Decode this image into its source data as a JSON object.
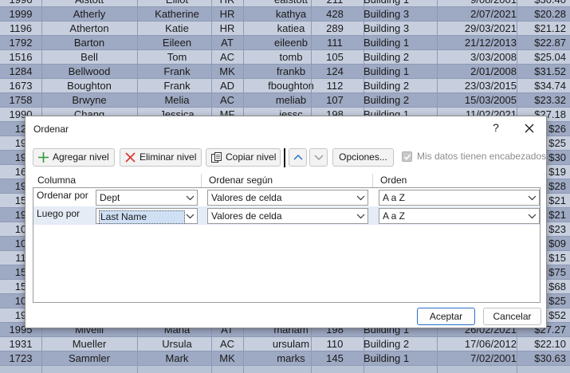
{
  "sheet": {
    "rows": [
      [
        "1996",
        "Alstott",
        "Elliot",
        "HR",
        "ealstott",
        "211",
        "Building 1",
        "9/08/2001",
        "$30.40"
      ],
      [
        "1999",
        "Atherly",
        "Katherine",
        "HR",
        "kathya",
        "428",
        "Building 3",
        "2/07/2021",
        "$20.28"
      ],
      [
        "1196",
        "Atherton",
        "Katie",
        "HR",
        "katiea",
        "289",
        "Building 3",
        "29/03/2021",
        "$21.12"
      ],
      [
        "1792",
        "Barton",
        "Eileen",
        "AT",
        "eileenb",
        "111",
        "Building 1",
        "21/12/2013",
        "$22.87"
      ],
      [
        "1516",
        "Bell",
        "Tom",
        "AC",
        "tomb",
        "105",
        "Building 2",
        "3/03/2008",
        "$25.04"
      ],
      [
        "1284",
        "Bellwood",
        "Frank",
        "MK",
        "frankb",
        "124",
        "Building 1",
        "2/01/2008",
        "$31.52"
      ],
      [
        "1673",
        "Boughton",
        "Frank",
        "AD",
        "fboughton",
        "112",
        "Building 2",
        "23/03/2015",
        "$34.74"
      ],
      [
        "1758",
        "Brwyne",
        "Melia",
        "AC",
        "meliab",
        "107",
        "Building 2",
        "15/03/2005",
        "$23.32"
      ],
      [
        "1990",
        "Chang",
        "Jessica",
        "MF",
        "jessc",
        "198",
        "Building 1",
        "11/02/2021",
        "$27.18"
      ],
      [
        "12",
        "",
        "",
        "",
        "",
        "",
        "",
        "",
        "$26"
      ],
      [
        "19",
        "",
        "",
        "",
        "",
        "",
        "",
        "",
        "$25"
      ],
      [
        "19",
        "",
        "",
        "",
        "",
        "",
        "",
        "",
        "$30"
      ],
      [
        "16",
        "",
        "",
        "",
        "",
        "",
        "",
        "",
        "$19"
      ],
      [
        "19",
        "",
        "",
        "",
        "",
        "",
        "",
        "",
        "$28"
      ],
      [
        "15",
        "",
        "",
        "",
        "",
        "",
        "",
        "",
        "$21"
      ],
      [
        "19",
        "",
        "",
        "",
        "",
        "",
        "",
        "",
        "$21"
      ],
      [
        "10",
        "",
        "",
        "",
        "",
        "",
        "",
        "",
        "$23"
      ],
      [
        "10",
        "",
        "",
        "",
        "",
        "",
        "",
        "",
        "$09"
      ],
      [
        "11",
        "",
        "",
        "",
        "",
        "",
        "",
        "",
        "$15"
      ],
      [
        "15",
        "",
        "",
        "",
        "",
        "",
        "",
        "",
        "$75"
      ],
      [
        "15",
        "",
        "",
        "",
        "",
        "",
        "",
        "",
        "$68"
      ],
      [
        "10",
        "",
        "",
        "",
        "",
        "",
        "",
        "",
        "$25"
      ],
      [
        "19",
        "",
        "",
        "",
        "",
        "",
        "",
        "",
        "$52"
      ],
      [
        "1995",
        "Mivelli",
        "Maria",
        "AT",
        "mariam",
        "198",
        "Building 1",
        "26/02/2021",
        "$27.27"
      ],
      [
        "1931",
        "Mueller",
        "Ursula",
        "AC",
        "ursulam",
        "110",
        "Building 2",
        "17/06/2012",
        "$22.10"
      ],
      [
        "1723",
        "Sammler",
        "Mark",
        "MK",
        "marks",
        "145",
        "Building 1",
        "7/02/2001",
        "$30.63"
      ]
    ]
  },
  "dialog": {
    "title": "Ordenar",
    "help": "?",
    "toolbar": {
      "add_level": "Agregar nivel",
      "delete_level": "Eliminar nivel",
      "copy_level": "Copiar nivel",
      "options": "Opciones...",
      "headers_checkbox": "Mis datos tienen encabezados",
      "headers_checked": true
    },
    "columns": {
      "column": "Columna",
      "sort_on": "Ordenar según",
      "order": "Orden"
    },
    "levels": [
      {
        "label": "Ordenar por",
        "column": "Dept",
        "sort_on": "Valores de celda",
        "order": "A a Z"
      },
      {
        "label": "Luego por",
        "column": "Last Name",
        "sort_on": "Valores de celda",
        "order": "A a Z"
      }
    ],
    "ok": "Aceptar",
    "cancel": "Cancelar"
  },
  "colors": {
    "accent": "#2a6fc9",
    "add_icon": "#2e9b3a",
    "delete_icon": "#d9342b"
  }
}
